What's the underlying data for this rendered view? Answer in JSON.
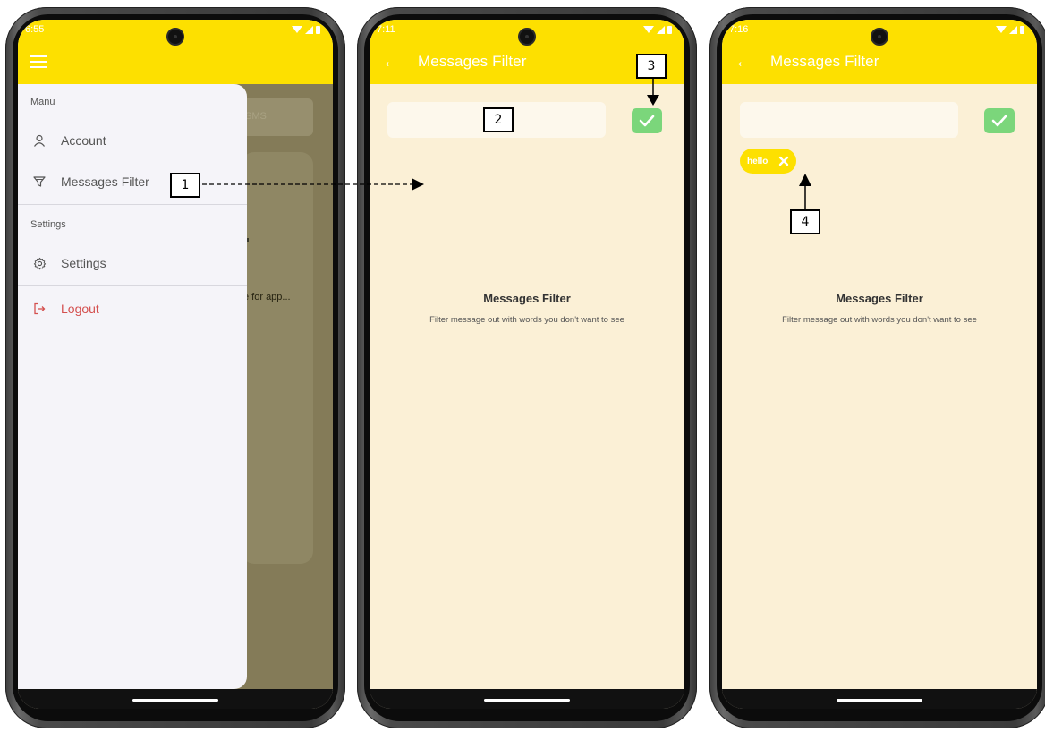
{
  "phone1": {
    "status_time": "6:55",
    "background": {
      "sms_label": "SMS",
      "truncated_text": "e for app..."
    },
    "drawer": {
      "section_menu": "Manu",
      "account_label": "Account",
      "messages_filter_label": "Messages Filter",
      "section_settings": "Settings",
      "settings_label": "Settings",
      "logout_label": "Logout"
    }
  },
  "phone2": {
    "status_time": "7:11",
    "appbar_title": "Messages Filter",
    "input_value": "",
    "empty_title": "Messages Filter",
    "empty_description": "Filter message out with words you don't want to see"
  },
  "phone3": {
    "status_time": "7:16",
    "appbar_title": "Messages Filter",
    "input_value": "",
    "chip_label": "hello",
    "empty_title": "Messages Filter",
    "empty_description": "Filter message out with words you don't want to see"
  },
  "annotations": [
    "1",
    "2",
    "3",
    "4"
  ],
  "colors": {
    "appbar": "#fde000",
    "content_bg": "#fbf0d6",
    "confirm": "#7bd67b",
    "logout": "#d4504f"
  }
}
